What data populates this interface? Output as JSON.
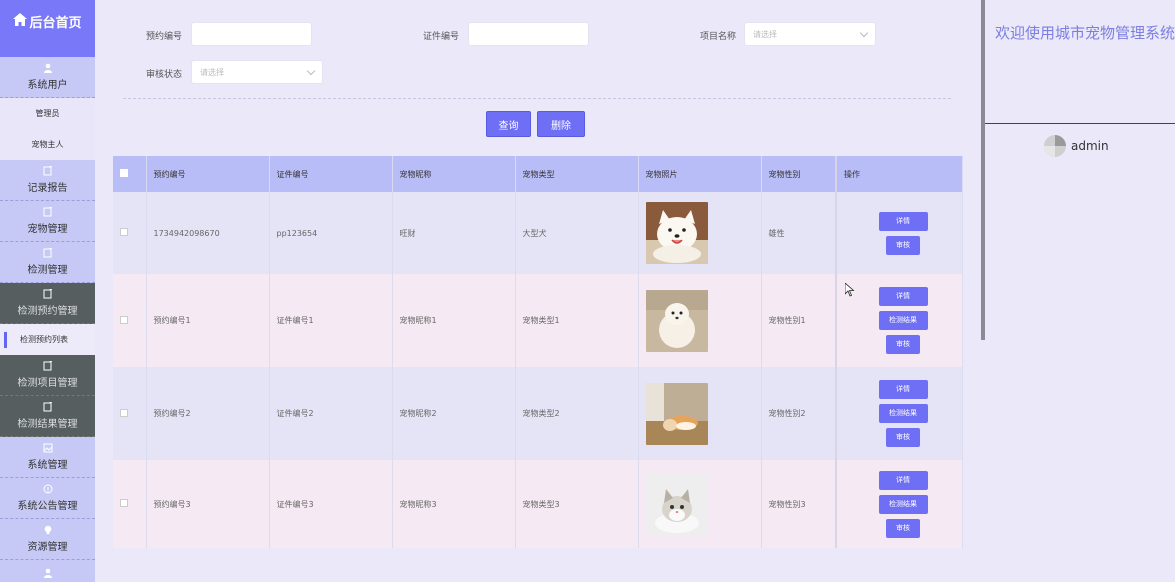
{
  "sidebar": {
    "logo": "后台首页",
    "groups": [
      {
        "label": "系统用户",
        "icon": "user-icon"
      },
      {
        "label": "记录报告",
        "icon": "doc-icon"
      },
      {
        "label": "宠物管理",
        "icon": "doc-icon"
      },
      {
        "label": "检测管理",
        "icon": "doc-icon"
      },
      {
        "label": "检测预约管理",
        "icon": "doc-icon"
      },
      {
        "label": "检测项目管理",
        "icon": "doc-icon"
      },
      {
        "label": "检测结果管理",
        "icon": "doc-icon"
      },
      {
        "label": "系统管理",
        "icon": "image-icon"
      },
      {
        "label": "系统公告管理",
        "icon": "info-icon"
      },
      {
        "label": "资源管理",
        "icon": "bulb-icon"
      }
    ],
    "subs": {
      "admin": "管理员",
      "owner": "宠物主人",
      "appointment_list": "检测预约列表"
    }
  },
  "filters": {
    "appointment_no_label": "预约编号",
    "appointment_no_value": "",
    "cert_no_label": "证件编号",
    "cert_no_value": "",
    "project_label": "项目名称",
    "project_placeholder": "请选择",
    "status_label": "审核状态",
    "status_placeholder": "请选择"
  },
  "actions": {
    "query": "查询",
    "delete": "删除"
  },
  "table": {
    "headers": [
      "预约编号",
      "证件编号",
      "宠物昵称",
      "宠物类型",
      "宠物照片",
      "宠物性别",
      "操作"
    ],
    "rows": [
      {
        "no": "1734942098670",
        "cert": "pp123654",
        "name": "旺财",
        "type": "大型犬",
        "sex": "雄性",
        "ops": [
          "详情",
          "审核"
        ]
      },
      {
        "no": "预约编号1",
        "cert": "证件编号1",
        "name": "宠物昵称1",
        "type": "宠物类型1",
        "sex": "宠物性别1",
        "ops": [
          "详情",
          "检测结果",
          "审核"
        ]
      },
      {
        "no": "预约编号2",
        "cert": "证件编号2",
        "name": "宠物昵称2",
        "type": "宠物类型2",
        "sex": "宠物性别2",
        "ops": [
          "详情",
          "检测结果",
          "审核"
        ]
      },
      {
        "no": "预约编号3",
        "cert": "证件编号3",
        "name": "宠物昵称3",
        "type": "宠物类型3",
        "sex": "宠物性别3",
        "ops": [
          "详情",
          "检测结果",
          "审核"
        ]
      }
    ]
  },
  "header": {
    "welcome": "欢迎使用城市宠物管理系统",
    "username": "admin"
  },
  "colors": {
    "accent": "#6f6ff5",
    "sidebar_bg": "#c6c9f5",
    "logo_bg": "#7878f8",
    "active_group_bg": "#565e60",
    "table_header": "#b9bdf7"
  }
}
